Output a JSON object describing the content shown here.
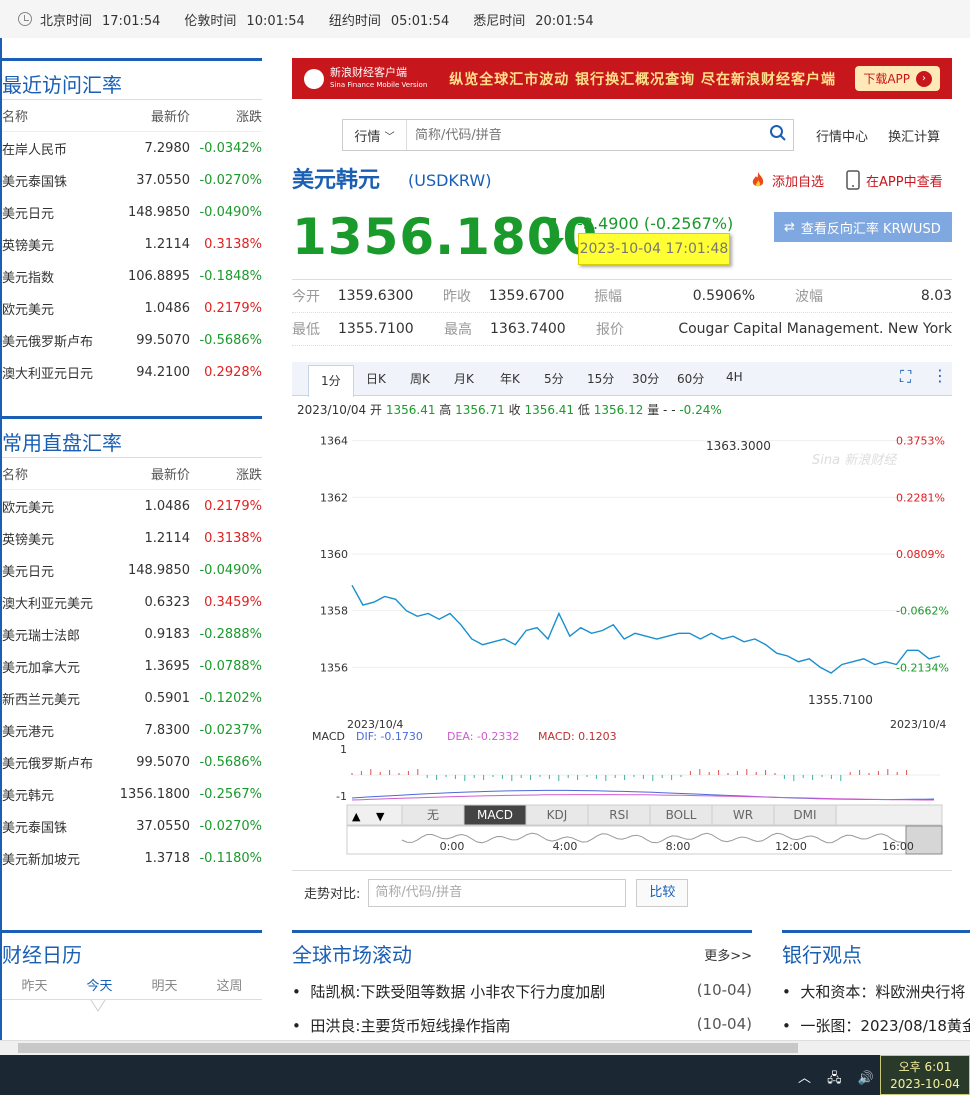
{
  "topbar": {
    "zones": [
      {
        "label": "北京时间",
        "time": "17:01:54"
      },
      {
        "label": "伦敦时间",
        "time": "10:01:54"
      },
      {
        "label": "纽约时间",
        "time": "05:01:54"
      },
      {
        "label": "悉尼时间",
        "time": "20:01:54"
      }
    ]
  },
  "recent": {
    "title": "最近访问汇率",
    "headers": {
      "name": "名称",
      "price": "最新价",
      "change": "涨跌"
    },
    "rows": [
      {
        "name": "在岸人民币",
        "price": "7.2980",
        "change": "-0.0342%",
        "dir": "down"
      },
      {
        "name": "美元泰国铢",
        "price": "37.0550",
        "change": "-0.0270%",
        "dir": "down"
      },
      {
        "name": "美元日元",
        "price": "148.9850",
        "change": "-0.0490%",
        "dir": "down"
      },
      {
        "name": "英镑美元",
        "price": "1.2114",
        "change": "0.3138%",
        "dir": "up"
      },
      {
        "name": "美元指数",
        "price": "106.8895",
        "change": "-0.1848%",
        "dir": "down"
      },
      {
        "name": "欧元美元",
        "price": "1.0486",
        "change": "0.2179%",
        "dir": "up"
      },
      {
        "name": "美元俄罗斯卢布",
        "price": "99.5070",
        "change": "-0.5686%",
        "dir": "down"
      },
      {
        "name": "澳大利亚元日元",
        "price": "94.2100",
        "change": "0.2928%",
        "dir": "up"
      }
    ]
  },
  "common": {
    "title": "常用直盘汇率",
    "headers": {
      "name": "名称",
      "price": "最新价",
      "change": "涨跌"
    },
    "rows": [
      {
        "name": "欧元美元",
        "price": "1.0486",
        "change": "0.2179%",
        "dir": "up"
      },
      {
        "name": "英镑美元",
        "price": "1.2114",
        "change": "0.3138%",
        "dir": "up"
      },
      {
        "name": "美元日元",
        "price": "148.9850",
        "change": "-0.0490%",
        "dir": "down"
      },
      {
        "name": "澳大利亚元美元",
        "price": "0.6323",
        "change": "0.3459%",
        "dir": "up"
      },
      {
        "name": "美元瑞士法郎",
        "price": "0.9183",
        "change": "-0.2888%",
        "dir": "down"
      },
      {
        "name": "美元加拿大元",
        "price": "1.3695",
        "change": "-0.0788%",
        "dir": "down"
      },
      {
        "name": "新西兰元美元",
        "price": "0.5901",
        "change": "-0.1202%",
        "dir": "down"
      },
      {
        "name": "美元港元",
        "price": "7.8300",
        "change": "-0.0237%",
        "dir": "down"
      },
      {
        "name": "美元俄罗斯卢布",
        "price": "99.5070",
        "change": "-0.5686%",
        "dir": "down"
      },
      {
        "name": "美元韩元",
        "price": "1356.1800",
        "change": "-0.2567%",
        "dir": "down"
      },
      {
        "name": "美元泰国铢",
        "price": "37.0550",
        "change": "-0.0270%",
        "dir": "down"
      },
      {
        "name": "美元新加坡元",
        "price": "1.3718",
        "change": "-0.1180%",
        "dir": "down"
      }
    ]
  },
  "banner": {
    "brand": "新浪财经客户端",
    "brand_en": "Sina Finance Mobile Version",
    "slogan": "纵览全球汇市波动  银行换汇概况查询  尽在新浪财经客户端",
    "download": "下载APP"
  },
  "search": {
    "select": "行情",
    "placeholder": "简称/代码/拼音"
  },
  "toplinks": {
    "center": "行情中心",
    "calc": "换汇计算"
  },
  "quote": {
    "title": "美元韩元",
    "code": "(USDKRW)",
    "add_fav": "添加自选",
    "app_view": "在APP中查看",
    "price": "1356.1800",
    "change": "-3.4900 (-0.2567%)",
    "timestamp": "2023-10-04 17:01:48",
    "reverse": "查看反向汇率 KRWUSD"
  },
  "stats": {
    "row1": [
      {
        "label": "今开",
        "value": "1359.6300"
      },
      {
        "label": "昨收",
        "value": "1359.6700"
      },
      {
        "label": "振幅",
        "value": "0.5906%"
      },
      {
        "label": "波幅",
        "value": "8.03"
      }
    ],
    "row2": [
      {
        "label": "最低",
        "value": "1355.7100"
      },
      {
        "label": "最高",
        "value": "1363.7400"
      },
      {
        "label": "报价",
        "value": "Cougar Capital Management. New York"
      }
    ]
  },
  "period_tabs": [
    "1分",
    "日K",
    "周K",
    "月K",
    "年K",
    "5分",
    "15分",
    "30分",
    "60分",
    "4H"
  ],
  "ohlc": {
    "date": "2023/10/04",
    "open_label": "开",
    "open": "1356.41",
    "high_label": "高",
    "high": "1356.71",
    "close_label": "收",
    "close": "1356.41",
    "low_label": "低",
    "low": "1356.12",
    "vol_label": "量",
    "vol": "-",
    "pct": "-0.24%"
  },
  "chart_data": {
    "type": "line",
    "y_ticks": [
      "1364",
      "1362",
      "1360",
      "1358",
      "1356"
    ],
    "right_ticks": [
      {
        "label": "0.3753%",
        "dir": "up"
      },
      {
        "label": "0.2281%",
        "dir": "up"
      },
      {
        "label": "0.0809%",
        "dir": "up"
      },
      {
        "label": "-0.0662%",
        "dir": "down"
      },
      {
        "label": "-0.2134%",
        "dir": "down"
      }
    ],
    "ylim": [
      1355.2,
      1364.2
    ],
    "high_label": "1363.3000",
    "low_label": "1355.7100",
    "x_start": "2023/10/4",
    "x_end": "2023/10/4",
    "values": [
      1358.9,
      1358.2,
      1358.3,
      1358.5,
      1358.4,
      1358.0,
      1357.8,
      1357.9,
      1357.7,
      1357.9,
      1357.5,
      1357.0,
      1356.8,
      1356.9,
      1357.0,
      1356.8,
      1357.3,
      1357.4,
      1357.0,
      1357.9,
      1357.1,
      1357.4,
      1357.2,
      1357.3,
      1357.5,
      1357.0,
      1357.2,
      1357.1,
      1357.0,
      1357.1,
      1357.2,
      1357.2,
      1357.0,
      1357.2,
      1357.0,
      1357.1,
      1356.9,
      1357.0,
      1356.8,
      1356.5,
      1356.4,
      1356.2,
      1356.3,
      1356.0,
      1355.8,
      1356.1,
      1356.2,
      1356.3,
      1356.1,
      1356.2,
      1356.1,
      1356.6,
      1356.6,
      1356.3,
      1356.4
    ],
    "macd": {
      "label": "MACD",
      "dif": "DIF: -0.1730",
      "dea": "DEA: -0.2332",
      "macd": "MACD: 0.1203",
      "ticks": [
        "1",
        "-1"
      ]
    },
    "indicator_tabs": [
      "无",
      "MACD",
      "KDJ",
      "RSI",
      "BOLL",
      "WR",
      "DMI"
    ],
    "time_ticks": [
      "0:00",
      "4:00",
      "8:00",
      "12:00",
      "16:00"
    ]
  },
  "compare": {
    "label": "走势对比:",
    "placeholder": "简称/代码/拼音",
    "button": "比较"
  },
  "calendar": {
    "title": "财经日历",
    "tabs": [
      "昨天",
      "今天",
      "明天",
      "这周"
    ]
  },
  "market": {
    "title": "全球市场滚动",
    "more": "更多>>",
    "items": [
      {
        "text": "陆凯枫:下跌受阻等数据 小非农下行力度加剧",
        "date": "(10-04)"
      },
      {
        "text": "田洪良:主要货币短线操作指南",
        "date": "(10-04)"
      }
    ]
  },
  "bank": {
    "title": "银行观点",
    "items": [
      "大和资本：料欧洲央行将",
      "一张图：2023/08/18黄金"
    ]
  },
  "taskbar": {
    "time": "오후 6:01",
    "date": "2023-10-04"
  }
}
